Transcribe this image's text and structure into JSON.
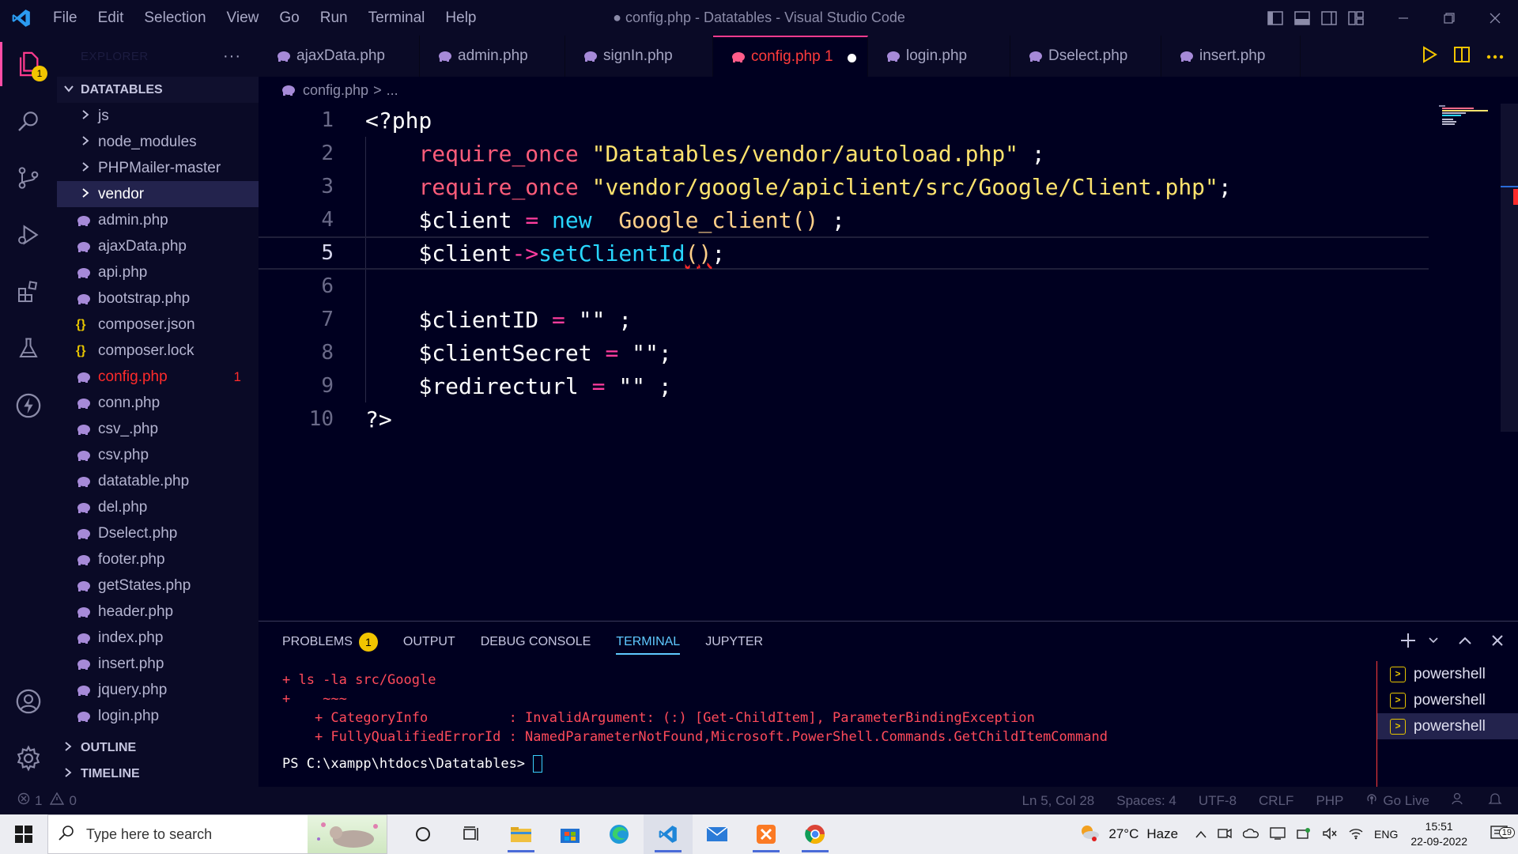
{
  "window": {
    "title": "config.php - Datatables - Visual Studio Code",
    "modified_dot": "●"
  },
  "menu": [
    "File",
    "Edit",
    "Selection",
    "View",
    "Go",
    "Run",
    "Terminal",
    "Help"
  ],
  "activity": {
    "explorer_badge": "1"
  },
  "sidebar": {
    "title": "EXPLORER",
    "more": "···",
    "root": "DATATABLES",
    "folders": [
      "js",
      "node_modules",
      "PHPMailer-master",
      "vendor"
    ],
    "selected_folder": "vendor",
    "files": [
      {
        "name": "admin.php",
        "type": "php"
      },
      {
        "name": "ajaxData.php",
        "type": "php"
      },
      {
        "name": "api.php",
        "type": "php"
      },
      {
        "name": "bootstrap.php",
        "type": "php"
      },
      {
        "name": "composer.json",
        "type": "json"
      },
      {
        "name": "composer.lock",
        "type": "json"
      },
      {
        "name": "config.php",
        "type": "php",
        "error": "1"
      },
      {
        "name": "conn.php",
        "type": "php"
      },
      {
        "name": "csv_.php",
        "type": "php"
      },
      {
        "name": "csv.php",
        "type": "php"
      },
      {
        "name": "datatable.php",
        "type": "php"
      },
      {
        "name": "del.php",
        "type": "php"
      },
      {
        "name": "Dselect.php",
        "type": "php"
      },
      {
        "name": "footer.php",
        "type": "php"
      },
      {
        "name": "getStates.php",
        "type": "php"
      },
      {
        "name": "header.php",
        "type": "php"
      },
      {
        "name": "index.php",
        "type": "php"
      },
      {
        "name": "insert.php",
        "type": "php"
      },
      {
        "name": "jquery.php",
        "type": "php"
      },
      {
        "name": "login.php",
        "type": "php"
      }
    ],
    "outline": "OUTLINE",
    "timeline": "TIMELINE",
    "json_glyph": "{}"
  },
  "tabs": [
    {
      "label": "ajaxData.php"
    },
    {
      "label": "admin.php"
    },
    {
      "label": "signIn.php"
    },
    {
      "label": "config.php 1",
      "active": true
    },
    {
      "label": "login.php"
    },
    {
      "label": "Dselect.php"
    },
    {
      "label": "insert.php"
    }
  ],
  "breadcrumb": {
    "file": "config.php",
    "sep": ">",
    "rest": "..."
  },
  "editor": {
    "line_numbers": [
      "1",
      "2",
      "3",
      "4",
      "5",
      "6",
      "7",
      "8",
      "9",
      "10"
    ],
    "current_line": 5,
    "line1": "<?php",
    "line2_kw": "require_once",
    "line2_str": "\"Datatables/vendor/autoload.php\"",
    "line2_end": " ;",
    "line3_kw": "require_once",
    "line3_str": "\"vendor/google/apiclient/src/Google/Client.php\"",
    "line3_end": ";",
    "line4_var": "$client",
    "line4_eq": "=",
    "line4_new": "new",
    "line4_cls": "Google_client()",
    "line4_end": " ;",
    "line5_var": "$client",
    "line5_arrow": "->",
    "line5_fn": "setClientId",
    "line5_paren_open": "(",
    "line5_paren_close": ")",
    "line5_end": ";",
    "line7_var": "$clientID",
    "line7_eq": "=",
    "line7_str": "\"\"",
    "line7_end": " ;",
    "line8_var": "$clientSecret",
    "line8_eq": "=",
    "line8_str": "\"\"",
    "line8_end": ";",
    "line9_var": "$redirecturl",
    "line9_eq": "=",
    "line9_str": "\"\"",
    "line9_end": " ;",
    "line10": "?>"
  },
  "panel": {
    "tabs": [
      "PROBLEMS",
      "OUTPUT",
      "DEBUG CONSOLE",
      "TERMINAL",
      "JUPYTER"
    ],
    "problems_badge": "1",
    "active_tab": "TERMINAL",
    "terminal_lines": [
      "+ ls -la src/Google",
      "+    ~~~",
      "    + CategoryInfo          : InvalidArgument: (:) [Get-ChildItem], ParameterBindingException",
      "    + FullyQualifiedErrorId : NamedParameterNotFound,Microsoft.PowerShell.Commands.GetChildItemCommand"
    ],
    "prompt": "PS C:\\xampp\\htdocs\\Datatables> ",
    "terminals": [
      "powershell",
      "powershell",
      "powershell"
    ],
    "active_terminal": 2,
    "ps_glyph": ">"
  },
  "status": {
    "errors": "1",
    "warnings": "0",
    "position": "Ln 5, Col 28",
    "spaces": "Spaces: 4",
    "encoding": "UTF-8",
    "eol": "CRLF",
    "language": "PHP",
    "golive": "Go Live"
  },
  "taskbar": {
    "search_placeholder": "Type here to search",
    "weather_temp": "27°C",
    "weather_desc": "Haze",
    "lang": "ENG",
    "time": "15:51",
    "date": "22-09-2022",
    "notif_count": "19"
  },
  "colors": {
    "accent_pink": "#ff3b8e",
    "error_red": "#ff2b2b",
    "badge_yellow": "#f2c500",
    "terminal_blue": "#5fc9ff",
    "background": "#000020"
  }
}
